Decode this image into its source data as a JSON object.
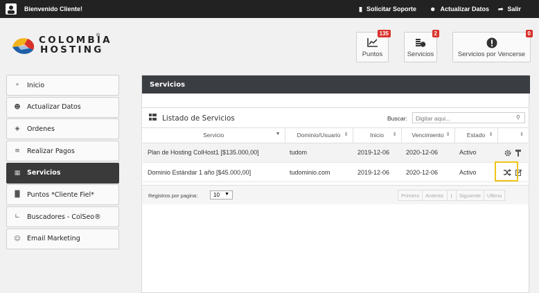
{
  "topbar": {
    "welcome": "Bienvenido Cliente!",
    "support": "Solicitar Soporte",
    "update": "Actualizar Datos",
    "logout": "Salir"
  },
  "logo": {
    "line1": "COLOMBIA",
    "line2": "HOSTING",
    "reg": "®"
  },
  "stats": [
    {
      "label": "Puntos",
      "badge": "135",
      "icon": "chart-icon"
    },
    {
      "label": "Servicios",
      "badge": "2",
      "icon": "coins-icon"
    },
    {
      "label": "Servicios por Vencerse",
      "badge": "0",
      "icon": "alert-icon"
    }
  ],
  "sidebar": {
    "items": [
      {
        "label": "Inicio",
        "icon": "home-icon"
      },
      {
        "label": "Actualizar Datos",
        "icon": "user-icon"
      },
      {
        "label": "Ordenes",
        "icon": "tag-icon"
      },
      {
        "label": "Realizar Pagos",
        "icon": "coins-icon"
      },
      {
        "label": "Servicios",
        "icon": "grid-icon",
        "active": true
      },
      {
        "label": "Puntos *Cliente Fiel*",
        "icon": "gift-icon"
      },
      {
        "label": "Buscadores - ColSeo®",
        "icon": "chart-icon"
      },
      {
        "label": "Email Marketing",
        "icon": "users-icon"
      }
    ]
  },
  "main": {
    "title": "Servicios",
    "panel_title": "Listado de Servicios",
    "search_label": "Buscar:",
    "search_placeholder": "Digitar aqui...",
    "columns": [
      "Servicio",
      "Dominio/Usuario",
      "Inicio",
      "Vencimiento",
      "Estado",
      ""
    ],
    "rows": [
      {
        "servicio": "Plan de Hosting ColHost1 [$135.000,00]",
        "dominio": "tudom",
        "inicio": "2019-12-06",
        "vencimiento": "2020-12-06",
        "estado": "Activo"
      },
      {
        "servicio": "Dominio Estándar 1 año [$45.000,00]",
        "dominio": "tudominio.com",
        "inicio": "2019-12-06",
        "vencimiento": "2020-12-06",
        "estado": "Activo"
      }
    ],
    "per_page_label": "Registros por pagina:",
    "per_page_value": "10",
    "pager": [
      "Primero",
      "Anterior",
      "1",
      "Siguiente",
      "Ultimo"
    ]
  },
  "colors": {
    "accent": "#d9322b",
    "highlight": "#f0c419",
    "dark": "#3a3a3a"
  }
}
